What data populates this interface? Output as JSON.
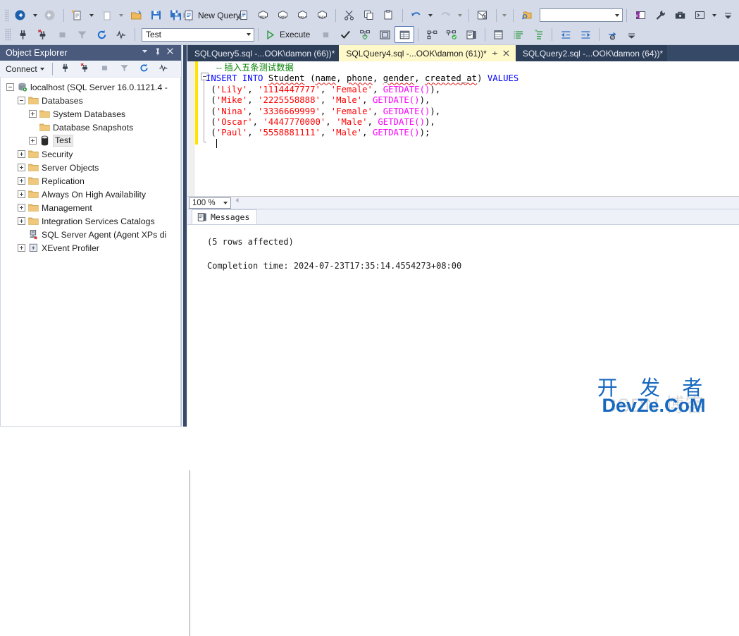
{
  "app": {
    "name": "SQL Server Management Studio",
    "theme_colors": {
      "toolbar_bg": "#d4dae8",
      "panel_title_bg": "#4a5a7d",
      "tab_strip_bg": "#364966",
      "active_tab_bg": "#fff9c9",
      "inactive_tab_bg": "#2d3e59",
      "accent_blue": "#1769c0",
      "keyword_blue": "#0000ff",
      "string_red": "#ff0000",
      "function_magenta": "#ff00ff",
      "comment_green": "#008000",
      "change_bar_yellow": "#ffe400"
    }
  },
  "toolbar_top": {
    "back_label": "Navigate Backward",
    "forward_label": "Navigate Forward",
    "new_project_label": "New Project",
    "add_new_item_label": "Add New Item",
    "open_file_label": "Open File",
    "save_label": "Save",
    "save_all_label": "Save All",
    "new_query_label": "New Query",
    "db_engine_query_label": "New Database Engine Query",
    "mdx_label": "MDX",
    "dmx_label": "DMX",
    "xmla_label": "XMLA",
    "dax_label": "DAX",
    "cut_label": "Cut",
    "copy_label": "Copy",
    "paste_label": "Paste",
    "undo_label": "Undo",
    "redo_label": "Redo",
    "summary_label": "Summary",
    "find_placeholder": "",
    "find_value": "",
    "toolbox_label": "Toolbox",
    "properties_label": "Properties",
    "options_label": "Options",
    "terminal_label": "Terminal",
    "overflow_label": "Toolbar Options"
  },
  "toolbar_query": {
    "connect_label": "Connect",
    "disconnect_label": "Disconnect",
    "database_value": "Test",
    "execute_label": "Execute",
    "stop_label": "Stop",
    "parse_label": "Parse",
    "display_estimated_plan_label": "Display Estimated Execution Plan",
    "query_options_label": "Query Options",
    "results_to_grid_label": "Results to Grid",
    "include_actual_plan_label": "Include Actual Execution Plan",
    "include_live_stats_label": "Include Live Query Statistics",
    "results_to_text_label": "Results to Text",
    "results_to_file_label": "Results to File",
    "comment_label": "Comment out selected lines",
    "uncomment_label": "Uncomment selected lines",
    "decrease_indent_label": "Decrease Indent",
    "increase_indent_label": "Increase Indent",
    "specify_values_label": "Specify Values for Template Parameters",
    "overflow_label": "Toolbar Options"
  },
  "object_explorer": {
    "title": "Object Explorer",
    "dropdown_label": "Window Position",
    "pin_label": "Auto Hide",
    "close_label": "Close",
    "connect_label": "Connect",
    "connect_button_label": "Connect",
    "disconnect_button_label": "Disconnect",
    "stop_button_label": "Stop",
    "filter_button_label": "Filter",
    "refresh_button_label": "Refresh",
    "activity_monitor_label": "Activity Monitor",
    "tree": [
      {
        "label": "localhost (SQL Server 16.0.1121.4 -",
        "indent": 0,
        "expander": "minus",
        "icon": "server-icon",
        "selected": false
      },
      {
        "label": "Databases",
        "indent": 1,
        "expander": "minus",
        "icon": "folder-icon",
        "selected": false
      },
      {
        "label": "System Databases",
        "indent": 2,
        "expander": "plus",
        "icon": "folder-icon",
        "selected": false
      },
      {
        "label": "Database Snapshots",
        "indent": 2,
        "expander": "none",
        "icon": "folder-icon",
        "selected": false
      },
      {
        "label": "Test",
        "indent": 2,
        "expander": "plus",
        "icon": "database-icon",
        "selected": true
      },
      {
        "label": "Security",
        "indent": 1,
        "expander": "plus",
        "icon": "folder-icon",
        "selected": false
      },
      {
        "label": "Server Objects",
        "indent": 1,
        "expander": "plus",
        "icon": "folder-icon",
        "selected": false
      },
      {
        "label": "Replication",
        "indent": 1,
        "expander": "plus",
        "icon": "folder-icon",
        "selected": false
      },
      {
        "label": "Always On High Availability",
        "indent": 1,
        "expander": "plus",
        "icon": "folder-icon",
        "selected": false
      },
      {
        "label": "Management",
        "indent": 1,
        "expander": "plus",
        "icon": "folder-icon",
        "selected": false
      },
      {
        "label": "Integration Services Catalogs",
        "indent": 1,
        "expander": "plus",
        "icon": "folder-icon",
        "selected": false
      },
      {
        "label": "SQL Server Agent (Agent XPs di",
        "indent": 1,
        "expander": "none",
        "icon": "agent-disabled-icon",
        "selected": false
      },
      {
        "label": "XEvent Profiler",
        "indent": 1,
        "expander": "plus",
        "icon": "xevent-icon",
        "selected": false
      }
    ]
  },
  "document_tabs": [
    {
      "label": "SQLQuery5.sql -...OOK\\damon (66))*",
      "active": false,
      "pinnable": false,
      "closable": false
    },
    {
      "label": "SQLQuery4.sql -...OOK\\damon (61))*",
      "active": true,
      "pinnable": true,
      "closable": true
    },
    {
      "label": "SQLQuery2.sql -...OOK\\damon (64))*",
      "active": false,
      "pinnable": false,
      "closable": false
    }
  ],
  "editor": {
    "comment": "-- 插入五条测试数据",
    "statement_keyword_1": "INSERT",
    "statement_keyword_2": "INTO",
    "table_name": "Student",
    "columns": [
      "name",
      "phone",
      "gender",
      "created_at"
    ],
    "values_keyword": "VALUES",
    "rows": [
      {
        "name": "'Lily'",
        "phone": "'1114447777'",
        "gender": "'Female'",
        "created": "GETDATE()",
        "terminator": ","
      },
      {
        "name": "'Mike'",
        "phone": "'2225558888'",
        "gender": "'Male'",
        "created": "GETDATE()",
        "terminator": ","
      },
      {
        "name": "'Nina'",
        "phone": "'3336669999'",
        "gender": "'Female'",
        "created": "GETDATE()",
        "terminator": ","
      },
      {
        "name": "'Oscar'",
        "phone": "'4447770000'",
        "gender": "'Male'",
        "created": "GETDATE()",
        "terminator": ","
      },
      {
        "name": "'Paul'",
        "phone": "'5558881111'",
        "gender": "'Male'",
        "created": "GETDATE()",
        "terminator": ";"
      }
    ]
  },
  "zoom_bar": {
    "zoom_value": "100 %",
    "scroll_left_label": "Scroll Left"
  },
  "results_pane": {
    "tab_label": "Messages",
    "messages": "(5 rows affected)\n\nCompletion time: 2024-07-23T17:35:14.4554273+08:00",
    "rows_affected": "(5 rows affected)",
    "completion_time": "Completion time: 2024-07-23T17:35:14.4554273+08:00"
  },
  "watermark": {
    "chinese": "开 发 者",
    "english": "DevZe.CoM",
    "ghost": "CSDN 博客"
  }
}
